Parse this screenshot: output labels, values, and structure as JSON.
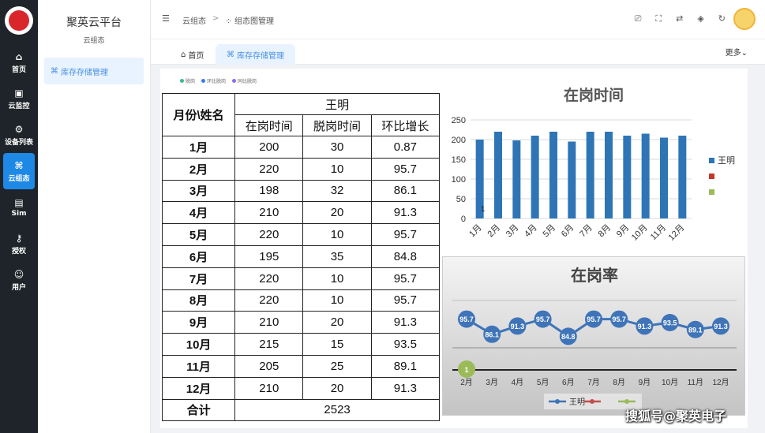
{
  "sidebar": {
    "items": [
      {
        "label": "首页",
        "icon": "home-icon"
      },
      {
        "label": "云监控",
        "icon": "monitor-icon"
      },
      {
        "label": "设备列表",
        "icon": "settings-icon"
      },
      {
        "label": "云组态",
        "icon": "config-icon",
        "active": true
      },
      {
        "label": "Sim",
        "icon": "sim-icon"
      },
      {
        "label": "授权",
        "icon": "key-icon"
      },
      {
        "label": "用户",
        "icon": "user-icon"
      }
    ]
  },
  "subnav": {
    "title": "聚英云平台",
    "subtitle": "云组态",
    "menu_item": "库存存储管理"
  },
  "header": {
    "breadcrumb": [
      "云组态",
      "组态图管理"
    ],
    "separator": ">"
  },
  "tabs": {
    "home": "首页",
    "active": "库存存储管理",
    "more": "更多"
  },
  "legend_strip": [
    "脱岗",
    "环比脱岗",
    "同比脱岗"
  ],
  "table": {
    "corner": "月份\\姓名",
    "person": "王明",
    "columns": [
      "在岗时间",
      "脱岗时间",
      "环比增长"
    ],
    "rows": [
      [
        "1月",
        "200",
        "30",
        "0.87"
      ],
      [
        "2月",
        "220",
        "10",
        "95.7"
      ],
      [
        "3月",
        "198",
        "32",
        "86.1"
      ],
      [
        "4月",
        "210",
        "20",
        "91.3"
      ],
      [
        "5月",
        "220",
        "10",
        "95.7"
      ],
      [
        "6月",
        "195",
        "35",
        "84.8"
      ],
      [
        "7月",
        "220",
        "10",
        "95.7"
      ],
      [
        "8月",
        "220",
        "10",
        "95.7"
      ],
      [
        "9月",
        "210",
        "20",
        "91.3"
      ],
      [
        "10月",
        "215",
        "15",
        "93.5"
      ],
      [
        "11月",
        "205",
        "25",
        "89.1"
      ],
      [
        "12月",
        "210",
        "20",
        "91.3"
      ]
    ],
    "total_label": "合计",
    "total_value": "2523"
  },
  "chart_data": [
    {
      "type": "bar",
      "title": "在岗时间",
      "categories": [
        "1月",
        "2月",
        "3月",
        "4月",
        "5月",
        "6月",
        "7月",
        "8月",
        "9月",
        "10月",
        "11月",
        "12月"
      ],
      "series": [
        {
          "name": "王明",
          "values": [
            200,
            220,
            198,
            210,
            220,
            195,
            220,
            220,
            210,
            215,
            205,
            210
          ],
          "color": "#2e75b6"
        },
        {
          "name": "",
          "values": [
            1,
            0,
            0,
            0,
            0,
            0,
            0,
            0,
            0,
            0,
            0,
            0
          ],
          "color": "#c0392b"
        },
        {
          "name": "",
          "values": [
            0,
            0,
            0,
            0,
            0,
            0,
            0,
            0,
            0,
            0,
            0,
            0
          ],
          "color": "#9bbb59"
        }
      ],
      "ylim": [
        0,
        250
      ],
      "yticks": [
        0,
        50,
        100,
        150,
        200,
        250
      ],
      "annotation": "1",
      "legend": "right",
      "grid": true
    },
    {
      "type": "line",
      "title": "在岗率",
      "categories": [
        "2月",
        "3月",
        "4月",
        "5月",
        "6月",
        "7月",
        "8月",
        "9月",
        "10月",
        "11月",
        "12月"
      ],
      "series": [
        {
          "name": "王明",
          "values": [
            95.7,
            86.1,
            91.3,
            95.7,
            84.8,
            95.7,
            95.7,
            91.3,
            93.5,
            89.1,
            91.3
          ],
          "color": "#3f74b8"
        },
        {
          "name": "",
          "values": [],
          "color": "#c0504d"
        },
        {
          "name": "",
          "values": [],
          "color": "#9bbb59"
        }
      ],
      "marker_label": "1",
      "legend": "bottom"
    }
  ],
  "watermark": "搜狐号@聚英电子"
}
